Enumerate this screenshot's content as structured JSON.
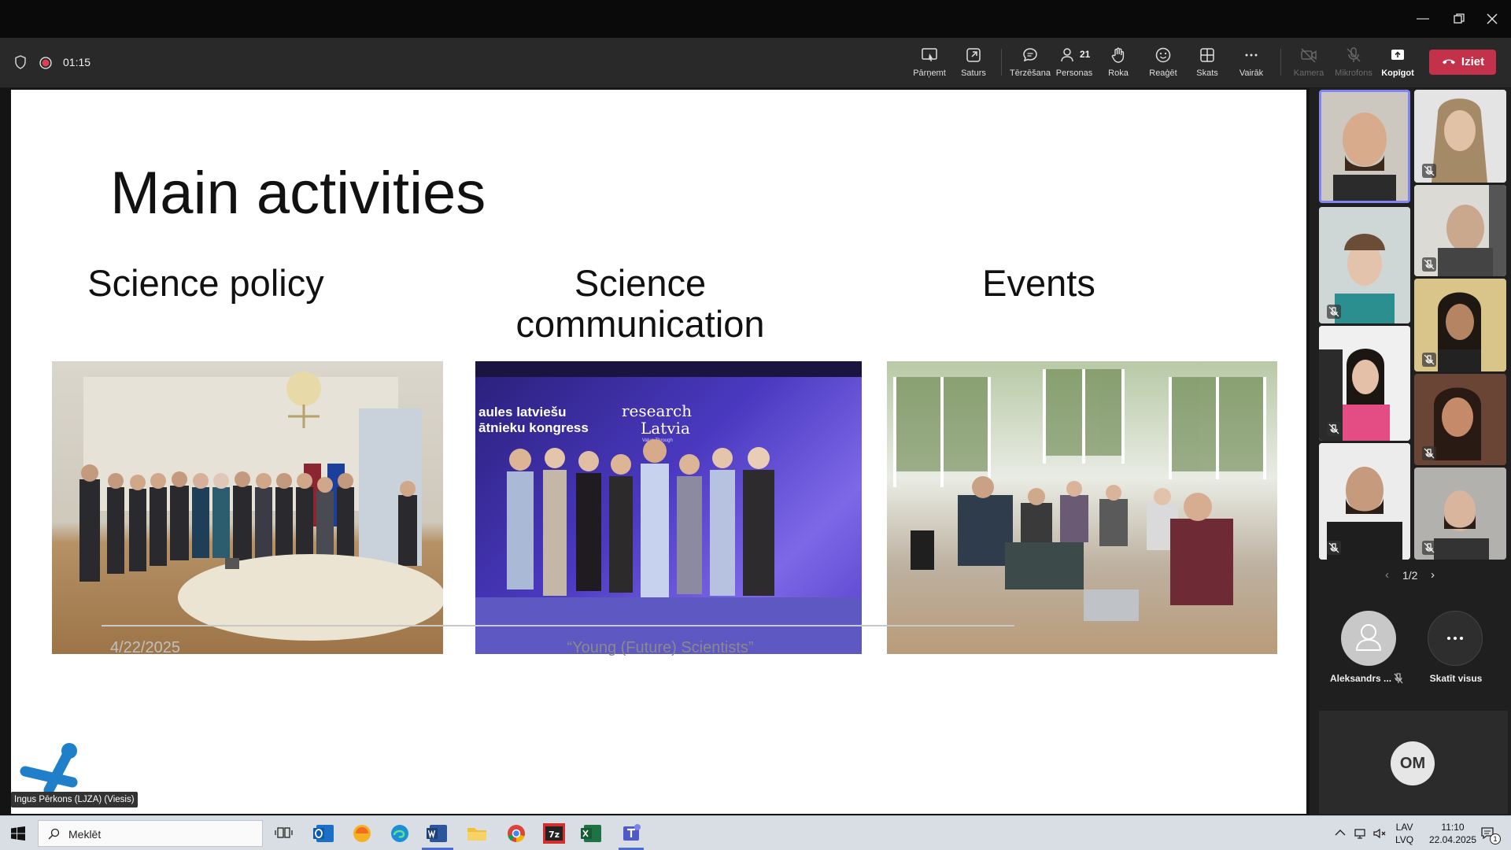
{
  "meeting": {
    "timer": "01:15"
  },
  "toolbar": {
    "buttons": [
      {
        "key": "takeover",
        "label": "Pārņemt"
      },
      {
        "key": "content",
        "label": "Saturs"
      },
      {
        "key": "chat",
        "label": "Tērzēšana"
      },
      {
        "key": "people",
        "label": "Personas",
        "count": "21"
      },
      {
        "key": "raise",
        "label": "Roka"
      },
      {
        "key": "react",
        "label": "Reaģēt"
      },
      {
        "key": "view",
        "label": "Skats"
      },
      {
        "key": "more",
        "label": "Vairāk"
      },
      {
        "key": "camera",
        "label": "Kamera"
      },
      {
        "key": "mic",
        "label": "Mikrofons"
      },
      {
        "key": "share",
        "label": "Kopīgot"
      }
    ],
    "leave_label": "Iziet"
  },
  "slide": {
    "title": "Main activities",
    "col1": "Science policy",
    "col2_line1": "Science",
    "col2_line2": "communication",
    "col3": "Events",
    "banner_line1": "aules latviešu",
    "banner_line2": "ātnieku kongress",
    "banner_brand1": "research",
    "banner_brand2": "Latvia",
    "banner_tag": "Value Through",
    "date": "4/22/2025",
    "footer": "“Young (Future) Scientists”",
    "presenter_label": "Ingus Pērkons (LJZA) (Viesis)"
  },
  "panel": {
    "pager": "1/2",
    "participant_name": "Aleksandrs ...",
    "see_all": "Skatīt visus",
    "initials": "OM"
  },
  "taskbar": {
    "search_placeholder": "Meklēt",
    "lang1": "LAV",
    "lang2": "LVQ",
    "time": "11:10",
    "date": "22.04.2025",
    "notif_count": "1"
  },
  "colors": {
    "leave": "#c4314b",
    "accent": "#6264a7",
    "logo": "#1f7fc9"
  }
}
